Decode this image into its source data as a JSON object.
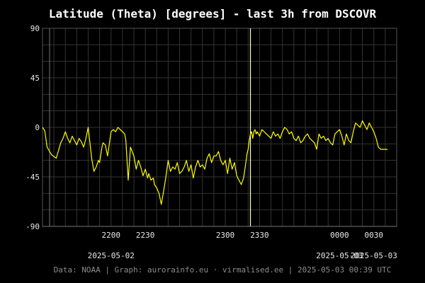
{
  "chart_data": {
    "type": "line",
    "title": "Latitude (Theta) [degrees] - last 3h from DSCOVR",
    "xlabel": "",
    "ylabel": "",
    "ylim": [
      -90,
      90
    ],
    "yticks": [
      "90",
      "45",
      "0",
      "-45",
      "-90"
    ],
    "y_tick_values": [
      90,
      45,
      0,
      -45,
      -90
    ],
    "x_ticks": [
      {
        "label": "2200",
        "t": 2200
      },
      {
        "label": "2230",
        "t": 2230
      },
      {
        "label": "2300",
        "t": 2300
      },
      {
        "label": "2330",
        "t": 2330
      },
      {
        "label": "0000",
        "t": 2400
      },
      {
        "label": "0030",
        "t": 2430
      }
    ],
    "x_dates": [
      {
        "label": "2025-05-02",
        "t": 2200
      },
      {
        "label": "2025-05-03",
        "t": 2400
      },
      {
        "label": "2025-05-03",
        "t": 2430
      }
    ],
    "xlim": [
      2140,
      2450
    ],
    "marker_time": 2322,
    "grid": true,
    "line_color": "#ffff00",
    "marker_color": "#ffffcc",
    "grid_color": "#333333",
    "series": [
      {
        "x": [
          2140,
          2142,
          2144,
          2148,
          2152,
          2156,
          2158,
          2160,
          2162,
          2164,
          2166,
          2168,
          2170,
          2172,
          2174,
          2176,
          2178,
          2180,
          2183,
          2185,
          2187,
          2189,
          2190,
          2192,
          2193,
          2195,
          2197,
          2200,
          2202,
          2204,
          2206,
          2208,
          2210,
          2212,
          2213,
          2215,
          2217,
          2220,
          2222,
          2224,
          2226,
          2228,
          2230,
          2232,
          2233,
          2235,
          2237,
          2238,
          2240,
          2242,
          2244,
          2246,
          2248,
          2250,
          2252,
          2254,
          2256,
          2258,
          2260,
          2262,
          2264,
          2266,
          2268,
          2270,
          2272,
          2274,
          2276,
          2278,
          2280,
          2282,
          2284,
          2286,
          2288,
          2290,
          2292,
          2294,
          2296,
          2298,
          2300,
          2302,
          2304,
          2306,
          2308,
          2310,
          2312,
          2314,
          2316,
          2318,
          2319,
          2320,
          2321,
          2322,
          2323,
          2324,
          2325,
          2326,
          2327,
          2328,
          2330,
          2332,
          2334,
          2336,
          2338,
          2340,
          2342,
          2344,
          2346,
          2348,
          2350,
          2352,
          2354,
          2356,
          2358,
          2360,
          2362,
          2364,
          2366,
          2368,
          2370,
          2372,
          2374,
          2376,
          2378,
          2380,
          2382,
          2384,
          2386,
          2388,
          2390,
          2392,
          2394,
          2396,
          2398,
          2400,
          2402,
          2404,
          2406,
          2408,
          2410,
          2412,
          2414,
          2416,
          2418,
          2420,
          2422,
          2424,
          2426,
          2428,
          2430,
          2432,
          2434,
          2436,
          2438,
          2440,
          2442
        ],
        "y": [
          0,
          -3,
          -18,
          -25,
          -28,
          -14,
          -10,
          -4,
          -10,
          -14,
          -8,
          -12,
          -16,
          -10,
          -13,
          -18,
          -10,
          0,
          -28,
          -40,
          -36,
          -30,
          -32,
          -18,
          -14,
          -16,
          -26,
          -4,
          -2,
          -4,
          0,
          -2,
          -4,
          -6,
          -12,
          -48,
          -18,
          -26,
          -38,
          -30,
          -36,
          -44,
          -38,
          -46,
          -42,
          -48,
          -46,
          -52,
          -55,
          -60,
          -70,
          -58,
          -45,
          -30,
          -40,
          -36,
          -38,
          -32,
          -42,
          -40,
          -36,
          -30,
          -40,
          -34,
          -46,
          -36,
          -30,
          -36,
          -34,
          -38,
          -28,
          -24,
          -32,
          -26,
          -26,
          -22,
          -30,
          -34,
          -30,
          -42,
          -28,
          -38,
          -32,
          -44,
          -48,
          -52,
          -46,
          -32,
          -24,
          -20,
          -12,
          -6,
          -4,
          -10,
          -4,
          -2,
          -6,
          -4,
          -8,
          -2,
          -4,
          -6,
          -8,
          -10,
          -4,
          -8,
          -6,
          -10,
          -4,
          0,
          -2,
          -6,
          -4,
          -10,
          -12,
          -8,
          -14,
          -12,
          -8,
          -6,
          -10,
          -12,
          -14,
          -20,
          -6,
          -10,
          -8,
          -12,
          -10,
          -14,
          -16,
          -6,
          -4,
          -2,
          -8,
          -16,
          -6,
          -12,
          -14,
          -4,
          4,
          2,
          0,
          6,
          2,
          -2,
          4,
          0,
          -4,
          -10,
          -18,
          -20,
          -20,
          -20,
          -20
        ]
      }
    ],
    "footer": "Data: NOAA | Graph: aurorainfo.eu · virmalised.ee | 2025-05-03 00:39 UTC"
  }
}
